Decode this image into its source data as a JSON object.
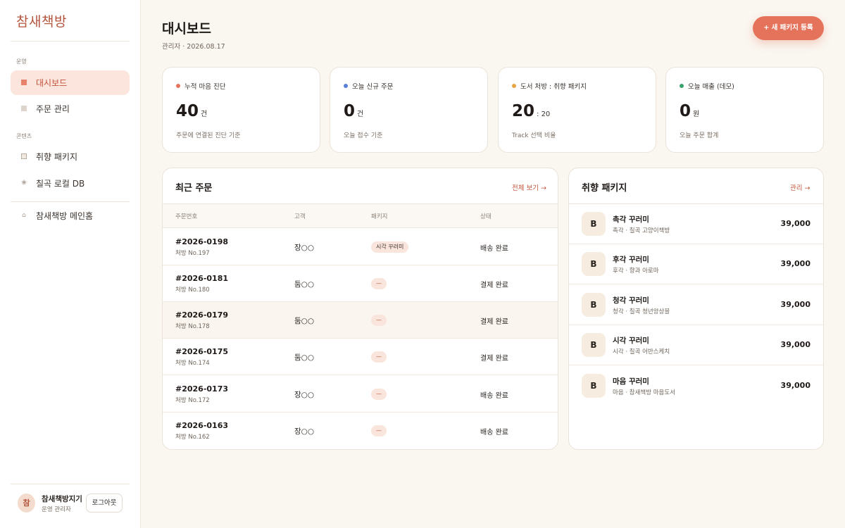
{
  "brand": "참새책방",
  "sidebar": {
    "sections": [
      "운영",
      "콘텐츠"
    ],
    "items": [
      {
        "label": "대시보드",
        "icon": "dashboard-icon"
      },
      {
        "label": "주문 관리",
        "icon": "orders-icon"
      },
      {
        "label": "취향 패키지",
        "icon": "package-icon"
      },
      {
        "label": "칠곡 로컬 DB",
        "icon": "database-icon"
      },
      {
        "label": "참새책방 메인홈",
        "icon": "home-icon"
      }
    ],
    "active_index": 0
  },
  "user": {
    "avatar": "참",
    "name": "참새책방지기",
    "role": "운영 관리자",
    "logout_label": "로그아웃"
  },
  "header": {
    "title": "대시보드",
    "subtitle": "관리자 · 2026.08.17",
    "new_package_label": "+ 새 패키지 등록"
  },
  "stats": [
    {
      "label": "누적 마음 진단",
      "value": "40",
      "unit": "건",
      "caption": "주문에 연결된 진단 기준",
      "dot_color": "#e5735b"
    },
    {
      "label": "오늘 신규 주문",
      "value": "0",
      "unit": "건",
      "caption": "오늘 접수 기준",
      "dot_color": "#5b7fd9"
    },
    {
      "label": "도서 처방 : 취향 패키지",
      "value": "20",
      "unit": ": 20",
      "caption": "Track 선택 비율",
      "dot_color": "#e8a640"
    },
    {
      "label": "오늘 매출 (데모)",
      "value": "0",
      "unit": "원",
      "caption": "오늘 주문 합계",
      "dot_color": "#3aa36a"
    }
  ],
  "orders": {
    "title": "최근 주문",
    "view_all_label": "전체 보기 →",
    "columns": [
      "주문번호",
      "고객",
      "패키지",
      "상태"
    ],
    "rows": [
      {
        "order_no": "#2026-0198",
        "rx": "처방 No.197",
        "customer": "장○○",
        "package": "시각 꾸러미",
        "status": "배송 완료"
      },
      {
        "order_no": "#2026-0181",
        "rx": "처방 No.180",
        "customer": "둠○○",
        "package": "—",
        "status": "결제 완료"
      },
      {
        "order_no": "#2026-0179",
        "rx": "처방 No.178",
        "customer": "둠○○",
        "package": "—",
        "status": "결제 완료"
      },
      {
        "order_no": "#2026-0175",
        "rx": "처방 No.174",
        "customer": "둠○○",
        "package": "—",
        "status": "결제 완료"
      },
      {
        "order_no": "#2026-0173",
        "rx": "처방 No.172",
        "customer": "장○○",
        "package": "—",
        "status": "배송 완료"
      },
      {
        "order_no": "#2026-0163",
        "rx": "처방 No.162",
        "customer": "장○○",
        "package": "—",
        "status": "배송 완료"
      }
    ]
  },
  "packages": {
    "title": "취향 패키지",
    "manage_label": "관리 →",
    "items": [
      {
        "badge": "B",
        "name": "촉각 꾸러미",
        "sub": "촉각 · 칠곡 고양이책방",
        "price": "39,000"
      },
      {
        "badge": "B",
        "name": "후각 꾸러미",
        "sub": "후각 · 향과 아로마",
        "price": "39,000"
      },
      {
        "badge": "B",
        "name": "청각 꾸러미",
        "sub": "청각 · 칠곡 청년앙상블",
        "price": "39,000"
      },
      {
        "badge": "B",
        "name": "시각 꾸러미",
        "sub": "시각 · 칠곡 어반스케치",
        "price": "39,000"
      },
      {
        "badge": "B",
        "name": "마음 꾸러미",
        "sub": "마음 · 참새책방 마음도서",
        "price": "39,000"
      }
    ]
  }
}
